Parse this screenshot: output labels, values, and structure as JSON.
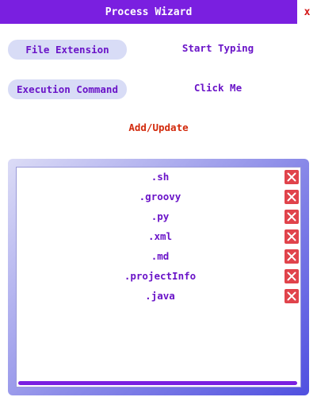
{
  "window": {
    "title": "Process Wizard",
    "close_label": "x"
  },
  "form": {
    "file_extension_button": "File Extension",
    "file_extension_field": "Start Typing",
    "execution_command_button": "Execution Command",
    "execution_command_field": "Click Me",
    "add_update_label": "Add/Update"
  },
  "extensions": [
    {
      "label": ".sh",
      "delete_icon": "close-icon"
    },
    {
      "label": ".groovy",
      "delete_icon": "close-icon"
    },
    {
      "label": ".py",
      "delete_icon": "close-icon"
    },
    {
      "label": ".xml",
      "delete_icon": "close-icon"
    },
    {
      "label": ".md",
      "delete_icon": "close-icon"
    },
    {
      "label": ".projectInfo",
      "delete_icon": "close-icon"
    },
    {
      "label": ".java",
      "delete_icon": "close-icon"
    }
  ],
  "colors": {
    "accent": "#7a1fe0",
    "text": "#6a14c8",
    "danger": "#e0434b",
    "add_update": "#d22a0c",
    "button_bg": "#d8dcf6"
  }
}
